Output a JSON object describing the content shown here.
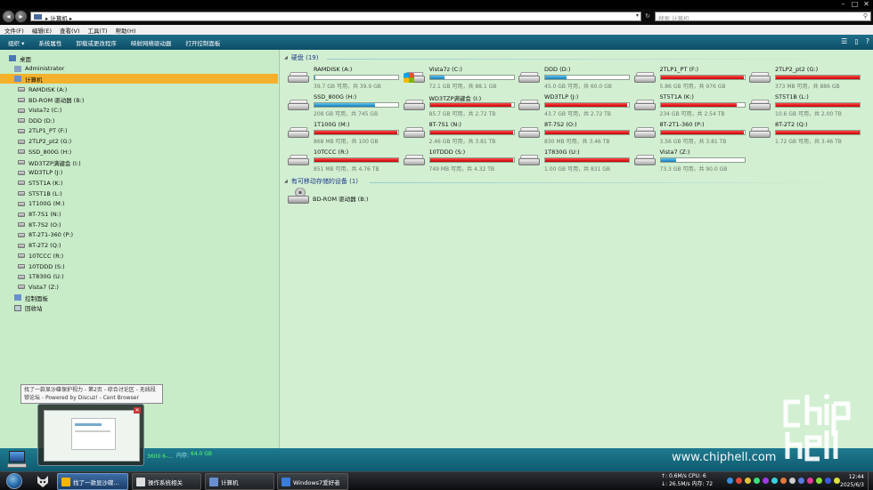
{
  "window": {
    "controls": [
      "–",
      "□",
      "✕"
    ]
  },
  "address": {
    "path": "▸ 计算机 ▸",
    "search_placeholder": "搜索 计算机"
  },
  "menu": [
    "文件(F)",
    "编辑(E)",
    "查看(V)",
    "工具(T)",
    "帮助(H)"
  ],
  "commands": [
    "组织 ▾",
    "系统属性",
    "卸载或更改程序",
    "映射网络驱动器",
    "打开控制面板"
  ],
  "nav": {
    "items": [
      {
        "label": "桌面",
        "icon": "desktop-icon"
      },
      {
        "label": "Administrator",
        "icon": "user-folder-icon"
      },
      {
        "label": "计算机",
        "icon": "computer-icon",
        "selected": true
      },
      {
        "label": "RAMDISK (A:)",
        "icon": "drive-icon"
      },
      {
        "label": "BD-ROM 驱动器 (B:)",
        "icon": "optical-drive-icon"
      },
      {
        "label": "Vista7z (C:)",
        "icon": "drive-icon"
      },
      {
        "label": "DDD (D:)",
        "icon": "drive-icon"
      },
      {
        "label": "2TLP1_PT (F:)",
        "icon": "drive-icon"
      },
      {
        "label": "2TLP2_pt2 (G:)",
        "icon": "drive-icon"
      },
      {
        "label": "SSD_800G (H:)",
        "icon": "drive-icon"
      },
      {
        "label": "WD3TZP满键会 (I:)",
        "icon": "drive-icon"
      },
      {
        "label": "WD3TLP (J:)",
        "icon": "drive-icon"
      },
      {
        "label": "ST5T1A (K:)",
        "icon": "drive-icon"
      },
      {
        "label": "ST5T1B (L:)",
        "icon": "drive-icon"
      },
      {
        "label": "1T100G (M:)",
        "icon": "drive-icon"
      },
      {
        "label": "8T-7S1 (N:)",
        "icon": "drive-icon"
      },
      {
        "label": "8T-7S2 (O:)",
        "icon": "drive-icon"
      },
      {
        "label": "8T-2T1-360 (P:)",
        "icon": "drive-icon"
      },
      {
        "label": "8T-2T2 (Q:)",
        "icon": "drive-icon"
      },
      {
        "label": "10TCCC (R:)",
        "icon": "drive-icon"
      },
      {
        "label": "10TDDD (S:)",
        "icon": "drive-icon"
      },
      {
        "label": "1T830G (U:)",
        "icon": "drive-icon"
      },
      {
        "label": "Vista7 (Z:)",
        "icon": "drive-icon"
      },
      {
        "label": "控制面板",
        "icon": "control-panel-icon"
      },
      {
        "label": "回收站",
        "icon": "recycle-bin-icon"
      }
    ]
  },
  "groups": {
    "hdd_title": "硬盘 (19)",
    "removable_title": "有可移动存储的设备 (1)",
    "removable_item": "BD-ROM 驱动器 (B:)"
  },
  "drives": [
    {
      "name": "RAMDISK (A:)",
      "info": "39.7 GB 可用，共 39.9 GB",
      "used": 0.005,
      "color": "blue",
      "icon": "drive"
    },
    {
      "name": "Vista7z (C:)",
      "info": "72.1 GB 可用，共 88.1 GB",
      "used": 0.18,
      "color": "blue",
      "icon": "windows"
    },
    {
      "name": "DDD (D:)",
      "info": "45.0 GB 可用，共 60.0 GB",
      "used": 0.25,
      "color": "blue",
      "icon": "drive"
    },
    {
      "name": "2TLP1_PT (F:)",
      "info": "5.86 GB 可用，共 976 GB",
      "used": 0.994,
      "color": "red",
      "icon": "drive"
    },
    {
      "name": "2TLP2_pt2 (G:)",
      "info": "373 MB 可用，共 886 GB",
      "used": 0.9996,
      "color": "red",
      "icon": "drive"
    },
    {
      "name": "SSD_800G (H:)",
      "info": "208 GB 可用，共 745 GB",
      "used": 0.72,
      "color": "blue",
      "icon": "drive"
    },
    {
      "name": "WD3TZP满键会 (I:)",
      "info": "85.7 GB 可用，共 2.72 TB",
      "used": 0.97,
      "color": "red",
      "icon": "drive"
    },
    {
      "name": "WD3TLP (J:)",
      "info": "43.7 GB 可用，共 2.72 TB",
      "used": 0.984,
      "color": "red",
      "icon": "drive"
    },
    {
      "name": "ST5T1A (K:)",
      "info": "234 GB 可用，共 2.54 TB",
      "used": 0.91,
      "color": "red",
      "icon": "drive"
    },
    {
      "name": "ST5T1B (L:)",
      "info": "10.6 GB 可用，共 2.00 TB",
      "used": 0.995,
      "color": "red",
      "icon": "drive"
    },
    {
      "name": "1T100G (M:)",
      "info": "868 MB 可用，共 100 GB",
      "used": 0.991,
      "color": "red",
      "icon": "drive"
    },
    {
      "name": "8T-7S1 (N:)",
      "info": "2.46 GB 可用，共 3.81 TB",
      "used": 0.999,
      "color": "red",
      "icon": "drive"
    },
    {
      "name": "8T-7S2 (O:)",
      "info": "830 MB 可用，共 3.46 TB",
      "used": 0.9998,
      "color": "red",
      "icon": "drive"
    },
    {
      "name": "8T-2T1-360 (P:)",
      "info": "3.56 GB 可用，共 3.81 TB",
      "used": 0.999,
      "color": "red",
      "icon": "drive"
    },
    {
      "name": "8T-2T2 (Q:)",
      "info": "1.72 GB 可用，共 3.46 TB",
      "used": 0.9995,
      "color": "red",
      "icon": "drive"
    },
    {
      "name": "10TCCC (R:)",
      "info": "851 MB 可用，共 4.76 TB",
      "used": 0.9998,
      "color": "red",
      "icon": "drive"
    },
    {
      "name": "10TDDD (S:)",
      "info": "749 MB 可用，共 4.32 TB",
      "used": 0.9998,
      "color": "red",
      "icon": "drive"
    },
    {
      "name": "1T830G (U:)",
      "info": "1.00 GB 可用，共 831 GB",
      "used": 0.9988,
      "color": "red",
      "icon": "drive"
    },
    {
      "name": "Vista7 (Z:)",
      "info": "73.3 GB 可用，共 90.0 GB",
      "used": 0.19,
      "color": "blue",
      "icon": "drive"
    }
  ],
  "details": {
    "mem_label": "内存:",
    "mem_value": "64.0 GB",
    "cpu_partial": "3600 6-..."
  },
  "tooltip": {
    "line1": "找了一款显沙碟保护视力 - 第2页 - 综合讨论区 - 无线段",
    "line2": "锁论坛 - Powered by Discuz! - Cent Browser"
  },
  "taskbar": {
    "tasks": [
      {
        "label": "找了一款显沙碟...",
        "active": true,
        "color": "#f7b500"
      },
      {
        "label": "操作系统相关",
        "active": false,
        "color": "#dddddd"
      },
      {
        "label": "计算机",
        "active": false,
        "color": "#6a8fd0"
      },
      {
        "label": "Windows7爱好者",
        "active": false,
        "color": "#3b7dd8"
      }
    ],
    "stats_line1": "↑: 0.6M/s   CPU: 6",
    "stats_line2": "↓: 26.5M/s  内存: 72",
    "time": "12:44",
    "date": "2025/6/3"
  },
  "watermark": {
    "url": "www.chiphell.com"
  }
}
